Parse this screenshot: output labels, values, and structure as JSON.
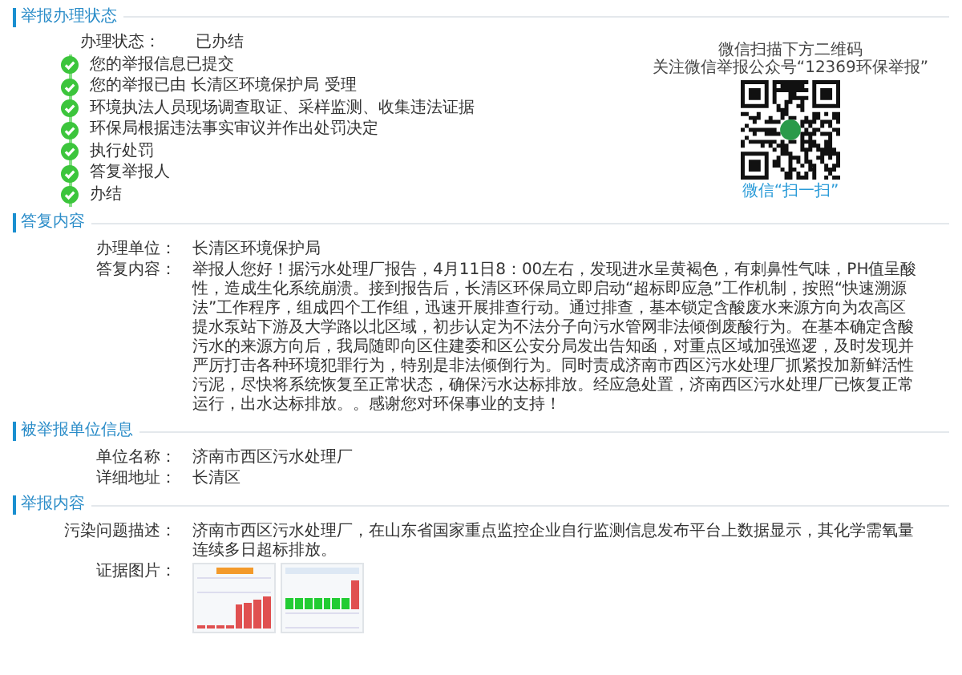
{
  "sections": [
    {
      "kind": "status",
      "title": "举报办理状态",
      "status_label": "办理状态：",
      "status_value": "已办结",
      "steps": [
        {
          "label": "您的举报信息已提交",
          "done": true
        },
        {
          "label": "您的举报已由 长清区环境保护局 受理",
          "done": true
        },
        {
          "label": "环境执法人员现场调查取证、采样监测、收集违法证据",
          "done": true
        },
        {
          "label": "环保局根据违法事实审议并作出处罚决定",
          "done": true
        },
        {
          "label": "执行处罚",
          "done": true
        },
        {
          "label": "答复举报人",
          "done": true
        },
        {
          "label": "办结",
          "done": true
        }
      ],
      "qr": {
        "line1": "微信扫描下方二维码",
        "line2": "关注微信举报公众号“12369环保举报”",
        "caption": "微信“扫一扫”"
      }
    },
    {
      "kind": "fields",
      "title": "答复内容",
      "fields": [
        {
          "label": "办理单位：",
          "value": "长清区环境保护局"
        },
        {
          "label": "答复内容：",
          "value": "举报人您好！据污水处理厂报告，4月11日8：00左右，发现进水呈黄褐色，有刺鼻性气味，PH值呈酸性，造成生化系统崩溃。接到报告后，长清区环保局立即启动“超标即应急”工作机制，按照“快速溯源法”工作程序，组成四个工作组，迅速开展排查行动。通过排查，基本锁定含酸废水来源方向为农高区提水泵站下游及大学路以北区域，初步认定为不法分子向污水管网非法倾倒废酸行为。在基本确定含酸污水的来源方向后，我局随即向区住建委和区公安分局发出告知函，对重点区域加强巡逻，及时发现并严厉打击各种环境犯罪行为，特别是非法倾倒行为。同时责成济南市西区污水处理厂抓紧投加新鲜活性污泥，尽快将系统恢复至正常状态，确保污水达标排放。经应急处置，济南西区污水处理厂已恢复正常运行，出水达标排放。。感谢您对环保事业的支持！"
        }
      ]
    },
    {
      "kind": "fields",
      "title": "被举报单位信息",
      "fields": [
        {
          "label": "单位名称：",
          "value": "济南市西区污水处理厂"
        },
        {
          "label": "详细地址：",
          "value": "长清区"
        }
      ]
    },
    {
      "kind": "fields",
      "title": "举报内容",
      "fields": [
        {
          "label": "污染问题描述：",
          "value": "济南市西区污水处理厂，在山东省国家重点监控企业自行监测信息发布平台上数据显示，其化学需氧量连续多日超标排放。"
        },
        {
          "label": "证据图片：",
          "images": [
            {
              "kind": "table"
            },
            {
              "kind": "chart"
            }
          ]
        }
      ]
    }
  ]
}
